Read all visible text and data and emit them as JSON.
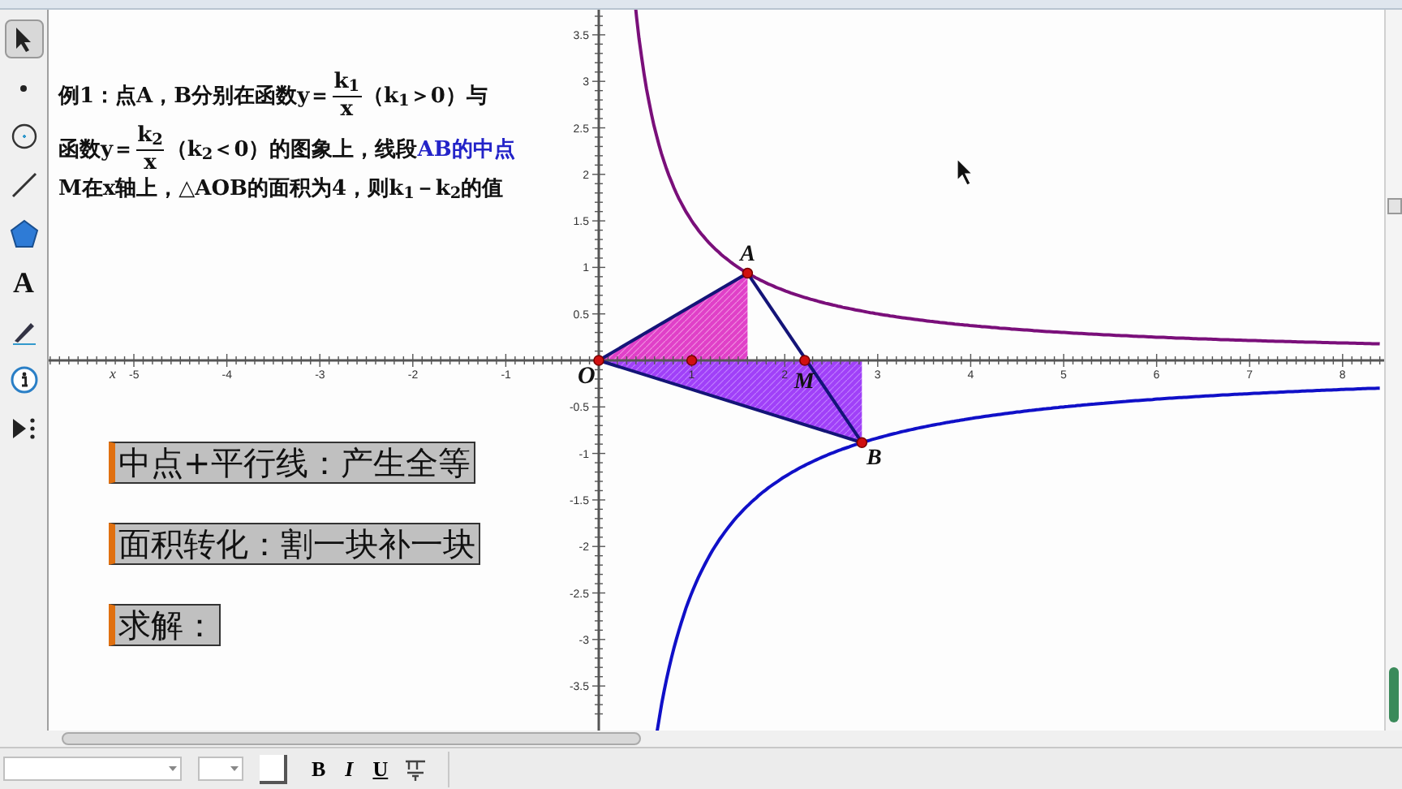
{
  "tools": [
    {
      "kind": "arrow",
      "selected": true
    },
    {
      "kind": "point",
      "selected": false
    },
    {
      "kind": "compass",
      "selected": false
    },
    {
      "kind": "line",
      "selected": false
    },
    {
      "kind": "polygon",
      "selected": false
    },
    {
      "kind": "text",
      "label": "A",
      "selected": false
    },
    {
      "kind": "marker",
      "selected": false
    },
    {
      "kind": "info",
      "selected": false
    },
    {
      "kind": "custom",
      "selected": false
    }
  ],
  "problem": [
    [
      {
        "kind": "text",
        "text": "例1：点A，B分别在函数y＝"
      },
      {
        "kind": "fraction",
        "numerator": "k$_{1}$",
        "denominator": "x"
      },
      {
        "kind": "text",
        "text": "（k$_{1}$＞0）与"
      }
    ],
    [
      {
        "kind": "text",
        "text": "函数y＝"
      },
      {
        "kind": "fraction",
        "numerator": "k$_{2}$",
        "denominator": "x"
      },
      {
        "kind": "text",
        "text": "（k$_{2}$＜0）的图象上，线段"
      },
      {
        "kind": "text",
        "text": "AB的中点",
        "emphasis": true
      }
    ],
    [
      {
        "kind": "text",
        "text": "M在x轴上，△AOB的面积为4，则k$_{1}$－k$_{2}$的值"
      }
    ]
  ],
  "captions": [
    "中点+平行线：产生全等",
    "面积转化：割一块补一块",
    "求解："
  ],
  "axes": {
    "x_name": "x",
    "origin": "O",
    "x_ticks_negative": [
      "-5",
      "-4",
      "-3",
      "-2",
      "-1"
    ],
    "x_ticks_positive": [
      "1",
      "2",
      "3",
      "4",
      "5",
      "6",
      "7",
      "8"
    ],
    "y_ticks_positive": [
      "3.5",
      "3",
      "2.5",
      "2",
      "1.5",
      "1",
      "0.5"
    ],
    "y_ticks_negative": [
      "-0.5",
      "-1",
      "-1.5",
      "-2",
      "-2.5",
      "-3",
      "-3.5"
    ]
  },
  "points": [
    "A",
    "M",
    "B"
  ],
  "text_toolbar": {
    "bold": "B",
    "italic": "I",
    "underline": "U"
  }
}
